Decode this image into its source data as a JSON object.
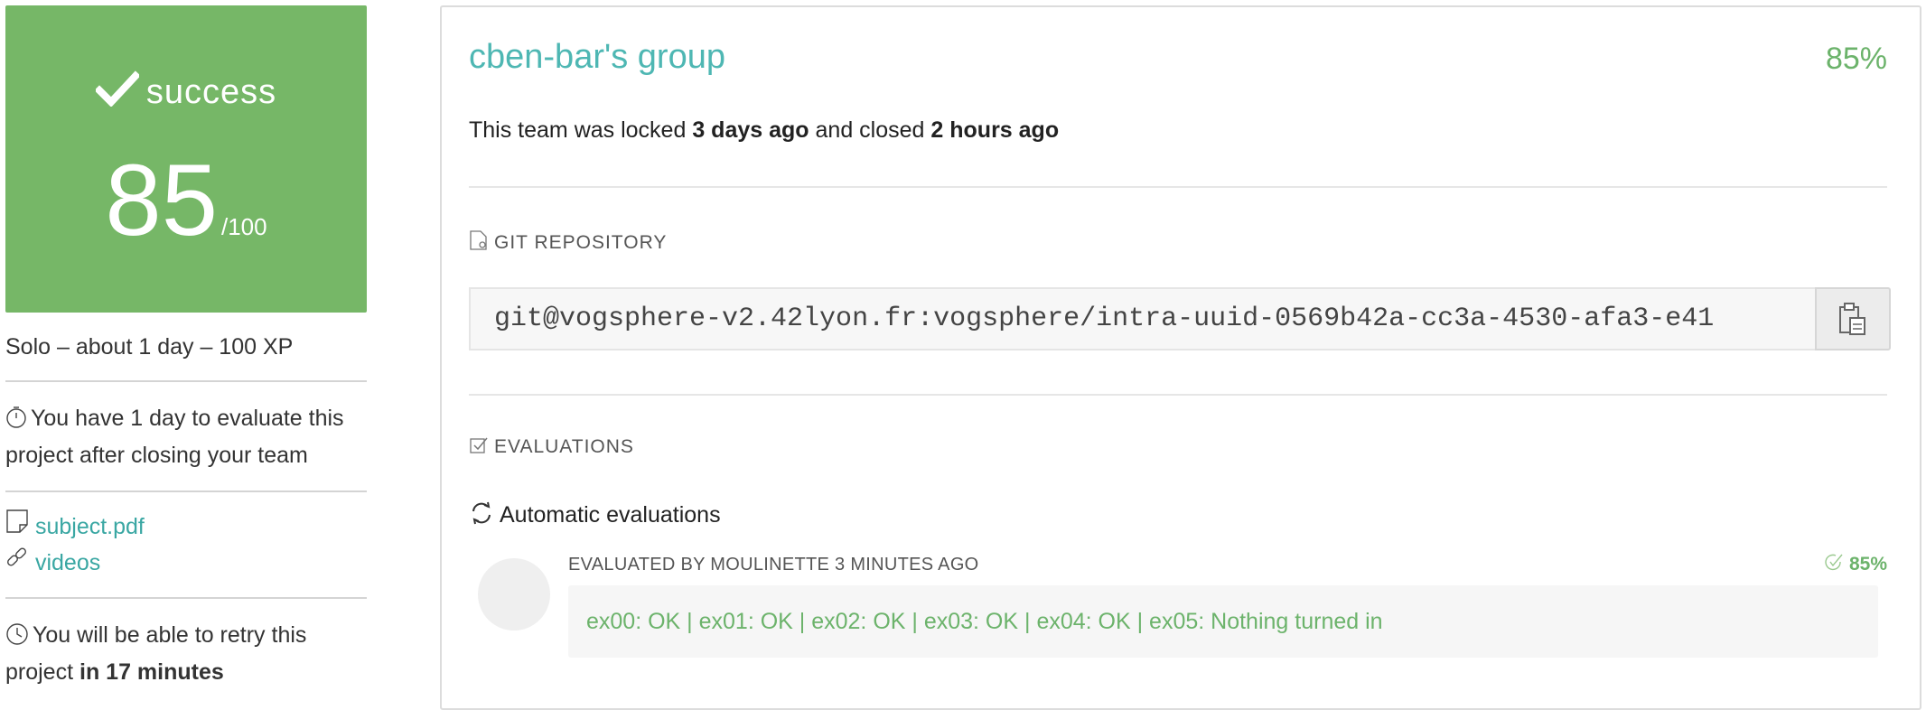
{
  "score_card": {
    "status": "success",
    "score": "85",
    "max": "/100",
    "color": "#76b767"
  },
  "project_meta": "Solo – about 1 day – 100 XP",
  "evaluate_notice": {
    "icon": "stopwatch-icon",
    "text": "You have 1 day to evaluate this project after closing your team"
  },
  "links": [
    {
      "icon": "document-icon",
      "label": "subject.pdf"
    },
    {
      "icon": "link-icon",
      "label": "videos"
    }
  ],
  "retry_notice": {
    "icon": "clock-icon",
    "prefix": "You will be able to retry this project",
    "bold": "in 17 minutes"
  },
  "team": {
    "title": "cben-bar's group",
    "percent": "85%",
    "lock_prefix": "This team was locked",
    "locked_ago": "3 days ago",
    "lock_mid": "and closed",
    "closed_ago": "2 hours ago"
  },
  "git": {
    "section_label": "GIT REPOSITORY",
    "url": "git@vogsphere-v2.42lyon.fr:vogsphere/intra-uuid-0569b42a-cc3a-4530-afa3-e41"
  },
  "evaluations": {
    "section_label": "EVALUATIONS",
    "auto_title": "Automatic evaluations",
    "evaluated_by": "EVALUATED BY MOULINETTE 3 MINUTES AGO",
    "percent": "85%",
    "result": "ex00: OK | ex01: OK | ex02: OK | ex03: OK | ex04: OK | ex05: Nothing turned in",
    "result_color": "#6cb36b"
  },
  "accent": "#3aa7a3"
}
